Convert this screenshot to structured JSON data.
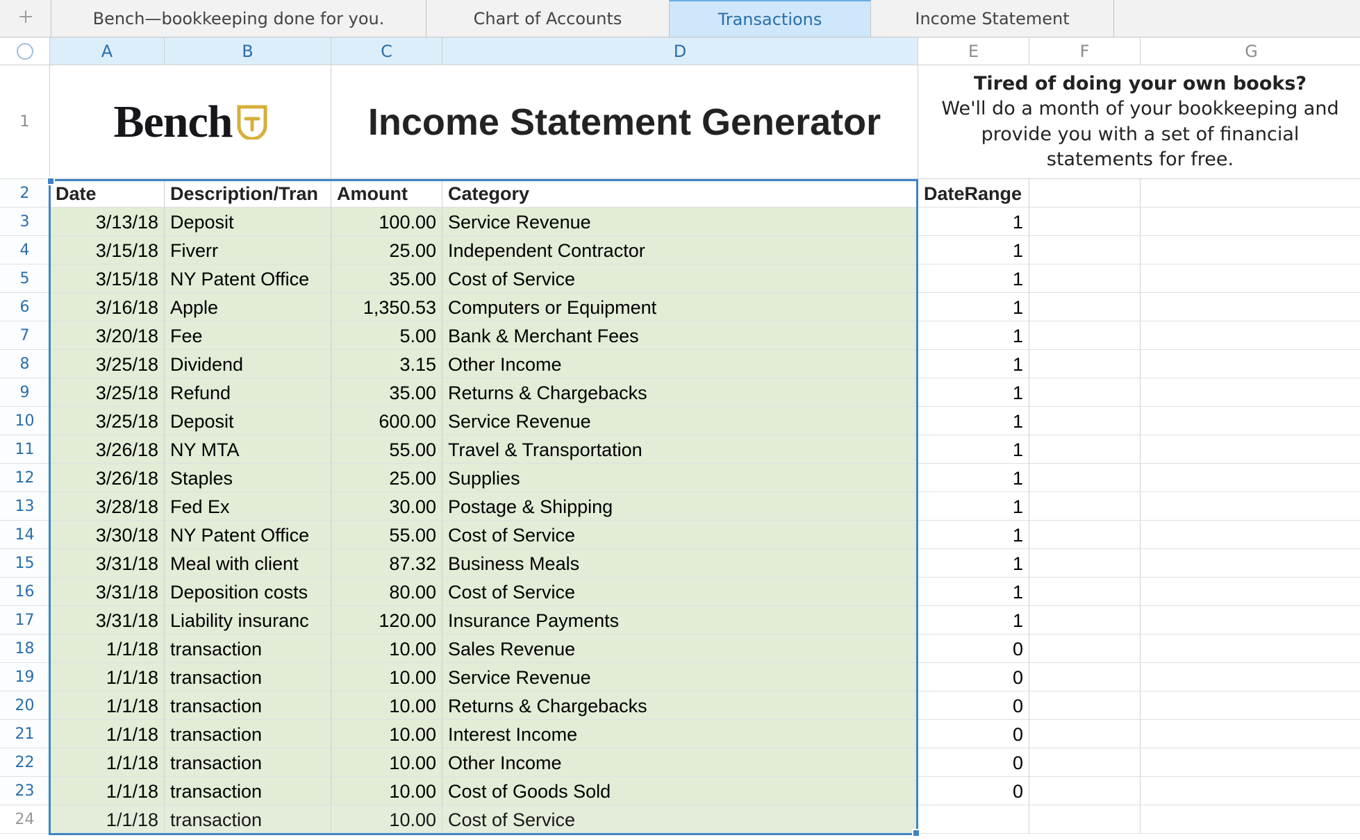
{
  "tabs": {
    "items": [
      "Bench—bookkeeping done for you.",
      "Chart of Accounts",
      "Transactions",
      "Income Statement"
    ],
    "active_index": 2
  },
  "columns": [
    "A",
    "B",
    "C",
    "D",
    "E",
    "F",
    "G"
  ],
  "row_numbers": [
    "1",
    "2",
    "3",
    "4",
    "5",
    "6",
    "7",
    "8",
    "9",
    "10",
    "11",
    "12",
    "13",
    "14",
    "15",
    "16",
    "17",
    "18",
    "19",
    "20",
    "21",
    "22",
    "23",
    "24"
  ],
  "title_row": {
    "logo_text": "Bench",
    "generator_title": "Income Statement Generator",
    "promo_line1": "Tired of doing your own books?",
    "promo_line2": "We'll do a month of your bookkeeping and provide you with a set of financial statements for free."
  },
  "labels": {
    "date": "Date",
    "desc": "Description/Tran",
    "amount": "Amount",
    "category": "Category",
    "daterange": "DateRange"
  },
  "rows": [
    {
      "date": "3/13/18",
      "desc": "Deposit",
      "amount": "100.00",
      "category": "Service Revenue",
      "dr": "1"
    },
    {
      "date": "3/15/18",
      "desc": "Fiverr",
      "amount": "25.00",
      "category": "Independent Contractor",
      "dr": "1"
    },
    {
      "date": "3/15/18",
      "desc": "NY Patent Office",
      "amount": "35.00",
      "category": "Cost of Service",
      "dr": "1"
    },
    {
      "date": "3/16/18",
      "desc": "Apple",
      "amount": "1,350.53",
      "category": "Computers or Equipment",
      "dr": "1"
    },
    {
      "date": "3/20/18",
      "desc": "Fee",
      "amount": "5.00",
      "category": "Bank & Merchant Fees",
      "dr": "1"
    },
    {
      "date": "3/25/18",
      "desc": "Dividend",
      "amount": "3.15",
      "category": "Other Income",
      "dr": "1"
    },
    {
      "date": "3/25/18",
      "desc": "Refund",
      "amount": "35.00",
      "category": "Returns & Chargebacks",
      "dr": "1"
    },
    {
      "date": "3/25/18",
      "desc": "Deposit",
      "amount": "600.00",
      "category": "Service Revenue",
      "dr": "1"
    },
    {
      "date": "3/26/18",
      "desc": "NY MTA",
      "amount": "55.00",
      "category": "Travel & Transportation",
      "dr": "1"
    },
    {
      "date": "3/26/18",
      "desc": "Staples",
      "amount": "25.00",
      "category": "Supplies",
      "dr": "1"
    },
    {
      "date": "3/28/18",
      "desc": "Fed Ex",
      "amount": "30.00",
      "category": "Postage & Shipping",
      "dr": "1"
    },
    {
      "date": "3/30/18",
      "desc": "NY Patent Office",
      "amount": "55.00",
      "category": "Cost of Service",
      "dr": "1"
    },
    {
      "date": "3/31/18",
      "desc": "Meal with client",
      "amount": "87.32",
      "category": "Business Meals",
      "dr": "1"
    },
    {
      "date": "3/31/18",
      "desc": "Deposition costs",
      "amount": "80.00",
      "category": "Cost of Service",
      "dr": "1"
    },
    {
      "date": "3/31/18",
      "desc": "Liability insuranc",
      "amount": "120.00",
      "category": "Insurance Payments",
      "dr": "1"
    },
    {
      "date": "1/1/18",
      "desc": "transaction",
      "amount": "10.00",
      "category": "Sales Revenue",
      "dr": "0"
    },
    {
      "date": "1/1/18",
      "desc": "transaction",
      "amount": "10.00",
      "category": "Service Revenue",
      "dr": "0"
    },
    {
      "date": "1/1/18",
      "desc": "transaction",
      "amount": "10.00",
      "category": "Returns & Chargebacks",
      "dr": "0"
    },
    {
      "date": "1/1/18",
      "desc": "transaction",
      "amount": "10.00",
      "category": "Interest Income",
      "dr": "0"
    },
    {
      "date": "1/1/18",
      "desc": "transaction",
      "amount": "10.00",
      "category": "Other Income",
      "dr": "0"
    },
    {
      "date": "1/1/18",
      "desc": "transaction",
      "amount": "10.00",
      "category": "Cost of Goods Sold",
      "dr": "0"
    },
    {
      "date": "1/1/18",
      "desc": "transaction",
      "amount": "10.00",
      "category": "Cost of Service",
      "dr": ""
    }
  ]
}
